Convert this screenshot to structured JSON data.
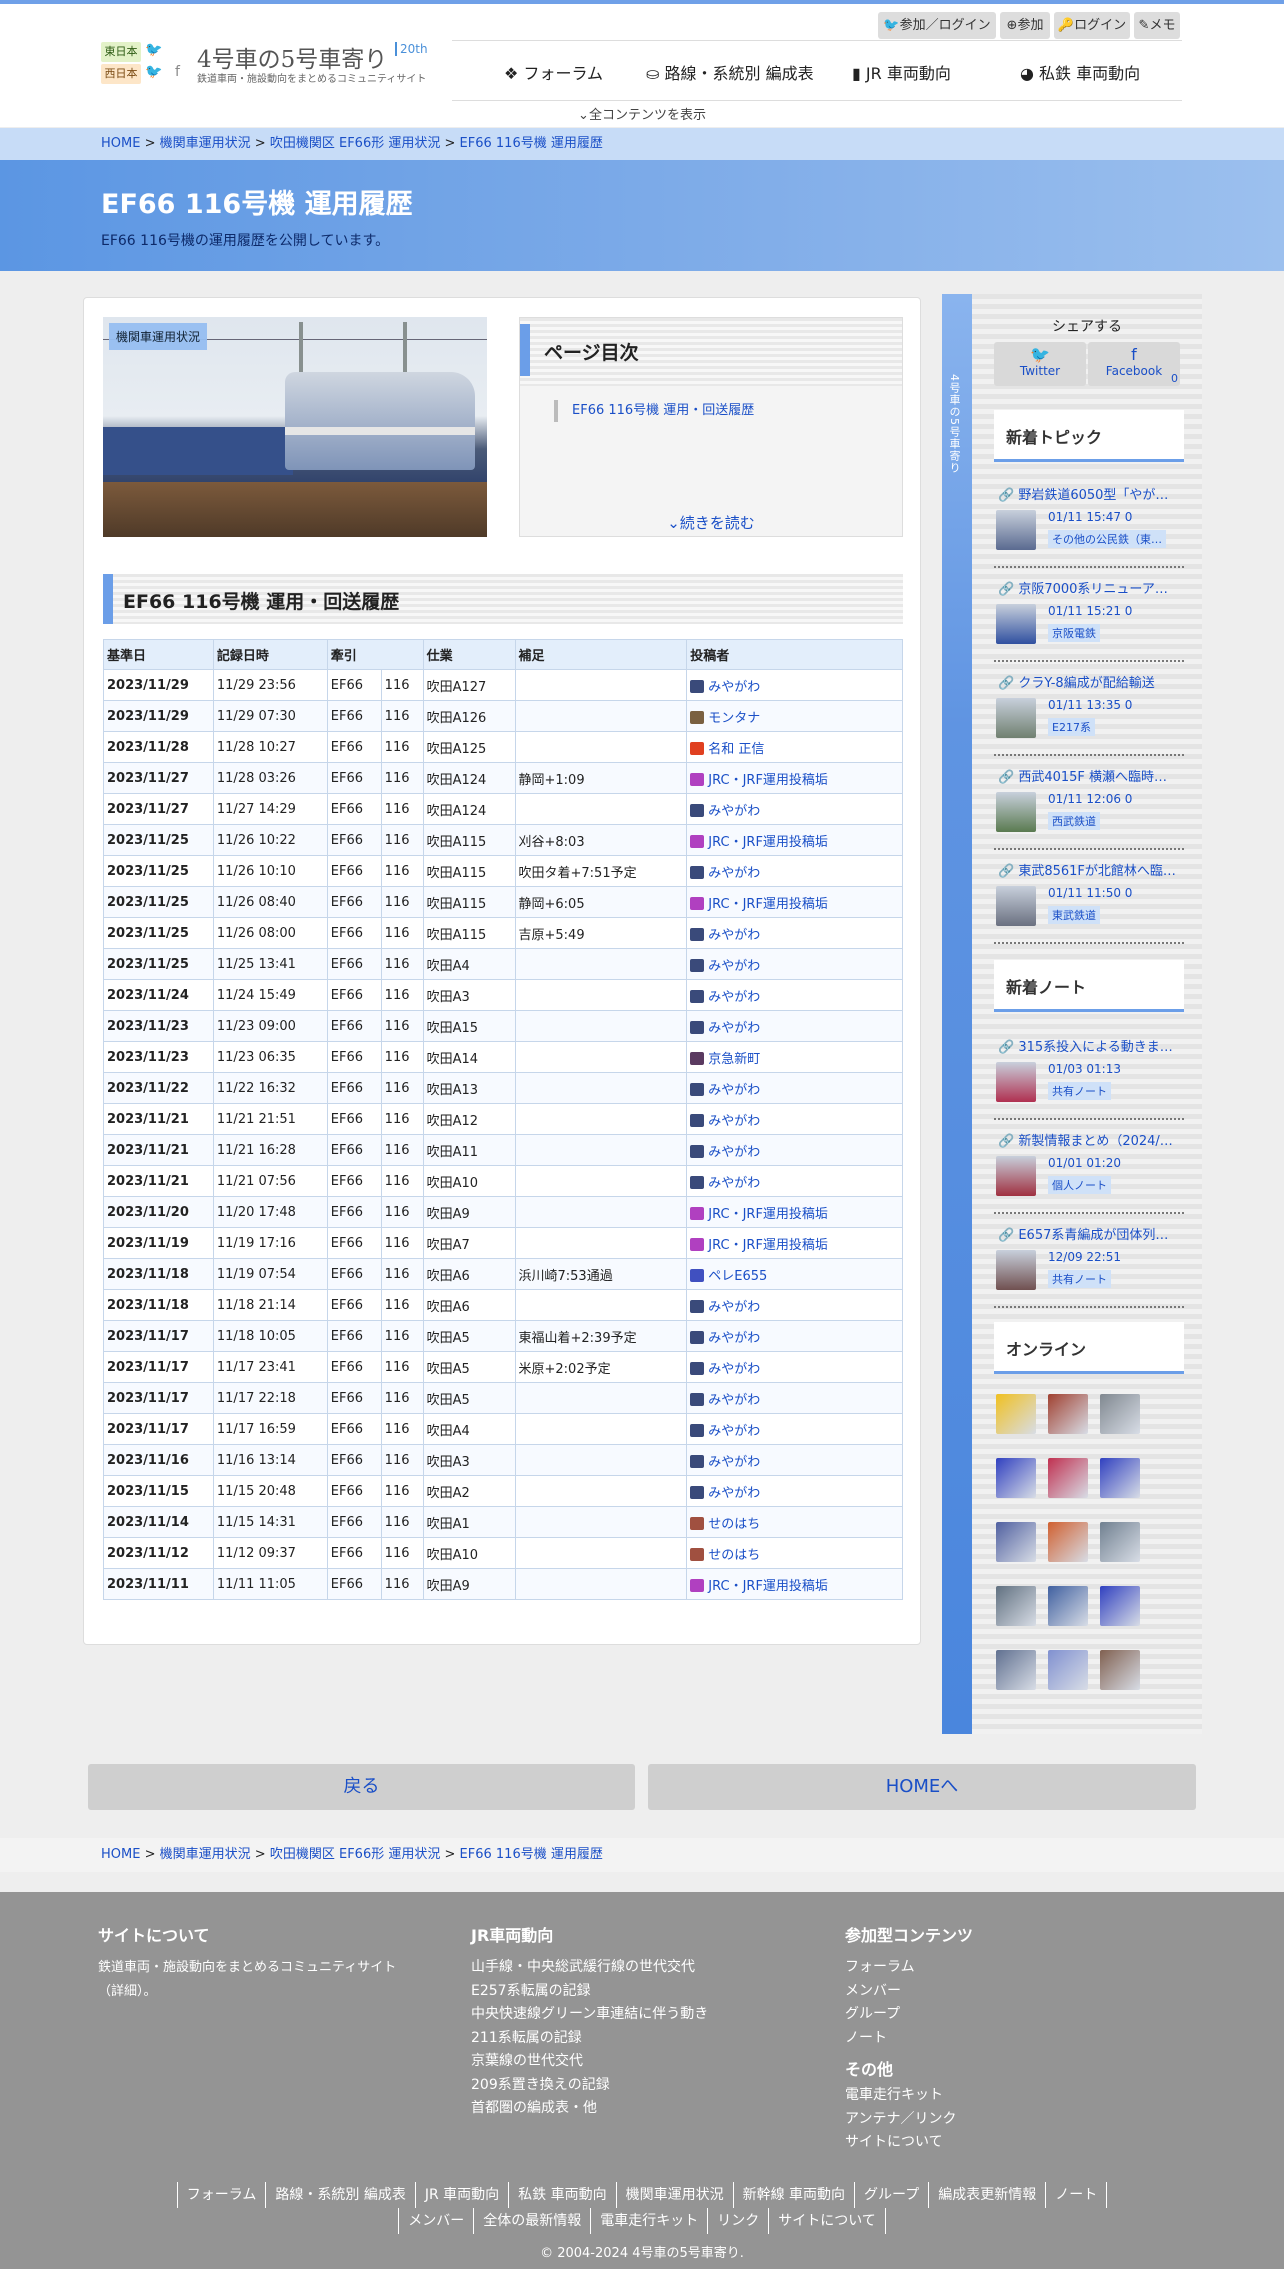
{
  "site": {
    "region_east": "東日本",
    "region_west": "西日本",
    "title": "4号車の5号車寄り",
    "subtitle": "鉄道車両・施設動向をまとめるコミュニティサイト",
    "badge": "20th"
  },
  "user_menu": {
    "join_login": "参加／ログイン",
    "join": "参加",
    "login": "ログイン",
    "memo": "メモ"
  },
  "nav": {
    "forum": "フォーラム",
    "formation": "路線・系統別 編成表",
    "jr": "JR 車両動向",
    "private": "私鉄 車両動向",
    "all_contents": "全コンテンツを表示"
  },
  "breadcrumb": {
    "home": "HOME",
    "b1": "機関車運用状況",
    "b2": "吹田機関区 EF66形 運用状況",
    "b3": "EF66 116号機 運用履歴",
    "sep": ">"
  },
  "hero": {
    "title": "EF66 116号機 運用履歴",
    "desc": "EF66 116号機の運用履歴を公開しています。"
  },
  "photo_tag": "機関車運用状況",
  "toc": {
    "title": "ページ目次",
    "item": "EF66 116号機 運用・回送履歴",
    "more": "続きを読む"
  },
  "section_title": "EF66 116号機 運用・回送履歴",
  "table": {
    "headers": [
      "基準日",
      "記録日時",
      "牽引",
      "",
      "仕業",
      "補足",
      "投稿者"
    ],
    "rows": [
      [
        "2023/11/29",
        "11/29 23:56",
        "EF66",
        "116",
        "吹田A127",
        "",
        "みやがわ"
      ],
      [
        "2023/11/29",
        "11/29 07:30",
        "EF66",
        "116",
        "吹田A126",
        "",
        "モンタナ"
      ],
      [
        "2023/11/28",
        "11/28 10:27",
        "EF66",
        "116",
        "吹田A125",
        "",
        "名和 正信"
      ],
      [
        "2023/11/27",
        "11/28 03:26",
        "EF66",
        "116",
        "吹田A124",
        "静岡+1:09",
        "JRC・JRF運用投稿垢"
      ],
      [
        "2023/11/27",
        "11/27 14:29",
        "EF66",
        "116",
        "吹田A124",
        "",
        "みやがわ"
      ],
      [
        "2023/11/25",
        "11/26 10:22",
        "EF66",
        "116",
        "吹田A115",
        "刈谷+8:03",
        "JRC・JRF運用投稿垢"
      ],
      [
        "2023/11/25",
        "11/26 10:10",
        "EF66",
        "116",
        "吹田A115",
        "吹田タ着+7:51予定",
        "みやがわ"
      ],
      [
        "2023/11/25",
        "11/26 08:40",
        "EF66",
        "116",
        "吹田A115",
        "静岡+6:05",
        "JRC・JRF運用投稿垢"
      ],
      [
        "2023/11/25",
        "11/26 08:00",
        "EF66",
        "116",
        "吹田A115",
        "吉原+5:49",
        "みやがわ"
      ],
      [
        "2023/11/25",
        "11/25 13:41",
        "EF66",
        "116",
        "吹田A4",
        "",
        "みやがわ"
      ],
      [
        "2023/11/24",
        "11/24 15:49",
        "EF66",
        "116",
        "吹田A3",
        "",
        "みやがわ"
      ],
      [
        "2023/11/23",
        "11/23 09:00",
        "EF66",
        "116",
        "吹田A15",
        "",
        "みやがわ"
      ],
      [
        "2023/11/23",
        "11/23 06:35",
        "EF66",
        "116",
        "吹田A14",
        "",
        "京急新町"
      ],
      [
        "2023/11/22",
        "11/22 16:32",
        "EF66",
        "116",
        "吹田A13",
        "",
        "みやがわ"
      ],
      [
        "2023/11/21",
        "11/21 21:51",
        "EF66",
        "116",
        "吹田A12",
        "",
        "みやがわ"
      ],
      [
        "2023/11/21",
        "11/21 16:28",
        "EF66",
        "116",
        "吹田A11",
        "",
        "みやがわ"
      ],
      [
        "2023/11/21",
        "11/21 07:56",
        "EF66",
        "116",
        "吹田A10",
        "",
        "みやがわ"
      ],
      [
        "2023/11/20",
        "11/20 17:48",
        "EF66",
        "116",
        "吹田A9",
        "",
        "JRC・JRF運用投稿垢"
      ],
      [
        "2023/11/19",
        "11/19 17:16",
        "EF66",
        "116",
        "吹田A7",
        "",
        "JRC・JRF運用投稿垢"
      ],
      [
        "2023/11/18",
        "11/19 07:54",
        "EF66",
        "116",
        "吹田A6",
        "浜川崎7:53通過",
        "ペレE655"
      ],
      [
        "2023/11/18",
        "11/18 21:14",
        "EF66",
        "116",
        "吹田A6",
        "",
        "みやがわ"
      ],
      [
        "2023/11/17",
        "11/18 10:05",
        "EF66",
        "116",
        "吹田A5",
        "東福山着+2:39予定",
        "みやがわ"
      ],
      [
        "2023/11/17",
        "11/17 23:41",
        "EF66",
        "116",
        "吹田A5",
        "米原+2:02予定",
        "みやがわ"
      ],
      [
        "2023/11/17",
        "11/17 22:18",
        "EF66",
        "116",
        "吹田A5",
        "",
        "みやがわ"
      ],
      [
        "2023/11/17",
        "11/17 16:59",
        "EF66",
        "116",
        "吹田A4",
        "",
        "みやがわ"
      ],
      [
        "2023/11/16",
        "11/16 13:14",
        "EF66",
        "116",
        "吹田A3",
        "",
        "みやがわ"
      ],
      [
        "2023/11/15",
        "11/15 20:48",
        "EF66",
        "116",
        "吹田A2",
        "",
        "みやがわ"
      ],
      [
        "2023/11/14",
        "11/15 14:31",
        "EF66",
        "116",
        "吹田A1",
        "",
        "せのはち"
      ],
      [
        "2023/11/12",
        "11/12 09:37",
        "EF66",
        "116",
        "吹田A10",
        "",
        "せのはち"
      ],
      [
        "2023/11/11",
        "11/11 11:05",
        "EF66",
        "116",
        "吹田A9",
        "",
        "JRC・JRF運用投稿垢"
      ]
    ],
    "avatar_colors": [
      "#3a4a7a",
      "#7a6040",
      "#e04020",
      "#b040c0",
      "#3a4a7a",
      "#b040c0",
      "#3a4a7a",
      "#b040c0",
      "#3a4a7a",
      "#3a4a7a",
      "#3a4a7a",
      "#3a4a7a",
      "#5a3a60",
      "#3a4a7a",
      "#3a4a7a",
      "#3a4a7a",
      "#3a4a7a",
      "#b040c0",
      "#b040c0",
      "#4050c0",
      "#3a4a7a",
      "#3a4a7a",
      "#3a4a7a",
      "#3a4a7a",
      "#3a4a7a",
      "#3a4a7a",
      "#3a4a7a",
      "#a05040",
      "#a05040",
      "#b040c0"
    ]
  },
  "sidebar": {
    "strip_text": "4号車の5号車寄り",
    "share_label": "シェアする",
    "twitter": "Twitter",
    "facebook": "Facebook",
    "facebook_count": "0",
    "topics_title": "新着トピック",
    "topics": [
      {
        "title": "野岩鉄道6050型「やが…",
        "meta": "01/11 15:47  0",
        "cat": "その他の公民鉄（東…",
        "color": "#5a6a90"
      },
      {
        "title": "京阪7000系リニューア…",
        "meta": "01/11 15:21  0",
        "cat": "京阪電鉄",
        "color": "#3050a0"
      },
      {
        "title": "クラY-8編成が配給輸送",
        "meta": "01/11 13:35  0",
        "cat": "E217系",
        "color": "#708070"
      },
      {
        "title": "西武4015F 横瀬へ臨時…",
        "meta": "01/11 12:06  0",
        "cat": "西武鉄道",
        "color": "#5a7a50"
      },
      {
        "title": "東武8561Fが北館林へ臨…",
        "meta": "01/11 11:50  0",
        "cat": "東武鉄道",
        "color": "#6a7080"
      }
    ],
    "notes_title": "新着ノート",
    "notes": [
      {
        "title": "315系投入による動きま…",
        "meta": "01/03 01:13",
        "cat": "共有ノート",
        "color": "#b03050"
      },
      {
        "title": "新製情報まとめ（2024/…",
        "meta": "01/01 01:20",
        "cat": "個人ノート",
        "color": "#a03040"
      },
      {
        "title": "E657系青編成が団体列…",
        "meta": "12/09 22:51",
        "cat": "共有ノート",
        "color": "#705050"
      }
    ],
    "online_title": "オンライン",
    "online_colors": [
      "#f0c020",
      "#a04030",
      "#808890",
      "#3040c0",
      "#c03050",
      "#3040c0",
      "#5060a0",
      "#d06030",
      "#708090",
      "#607080",
      "#4060a0",
      "#3040c0",
      "#607090",
      "#8090d0",
      "#806050"
    ]
  },
  "buttons": {
    "back": "戻る",
    "home": "HOMEへ"
  },
  "footer": {
    "about_title": "サイトについて",
    "about_text1": "鉄道車両・施設動向をまとめるコミュニティサイト",
    "about_text2": "（詳細）。",
    "jr_title": "JR車両動向",
    "jr_links": [
      "山手線・中央総武緩行線の世代交代",
      "E257系転属の記録",
      "中央快速線グリーン車連結に伴う動き",
      "211系転属の記録",
      "京葉線の世代交代",
      "209系置き換えの記録",
      "首都圏の編成表・他"
    ],
    "participate_title": "参加型コンテンツ",
    "participate_links": [
      "フォーラム",
      "メンバー",
      "グループ",
      "ノート"
    ],
    "other_title": "その他",
    "other_links": [
      "電車走行キット",
      "アンテナ／リンク",
      "サイトについて"
    ],
    "nav1": [
      "フォーラム",
      "路線・系統別 編成表",
      "JR 車両動向",
      "私鉄 車両動向",
      "機関車運用状況",
      "新幹線 車両動向",
      "グループ",
      "編成表更新情報",
      "ノート"
    ],
    "nav2": [
      "メンバー",
      "全体の最新情報",
      "電車走行キット",
      "リンク",
      "サイトについて"
    ],
    "copyright": "© 2004-2024 4号車の5号車寄り."
  }
}
